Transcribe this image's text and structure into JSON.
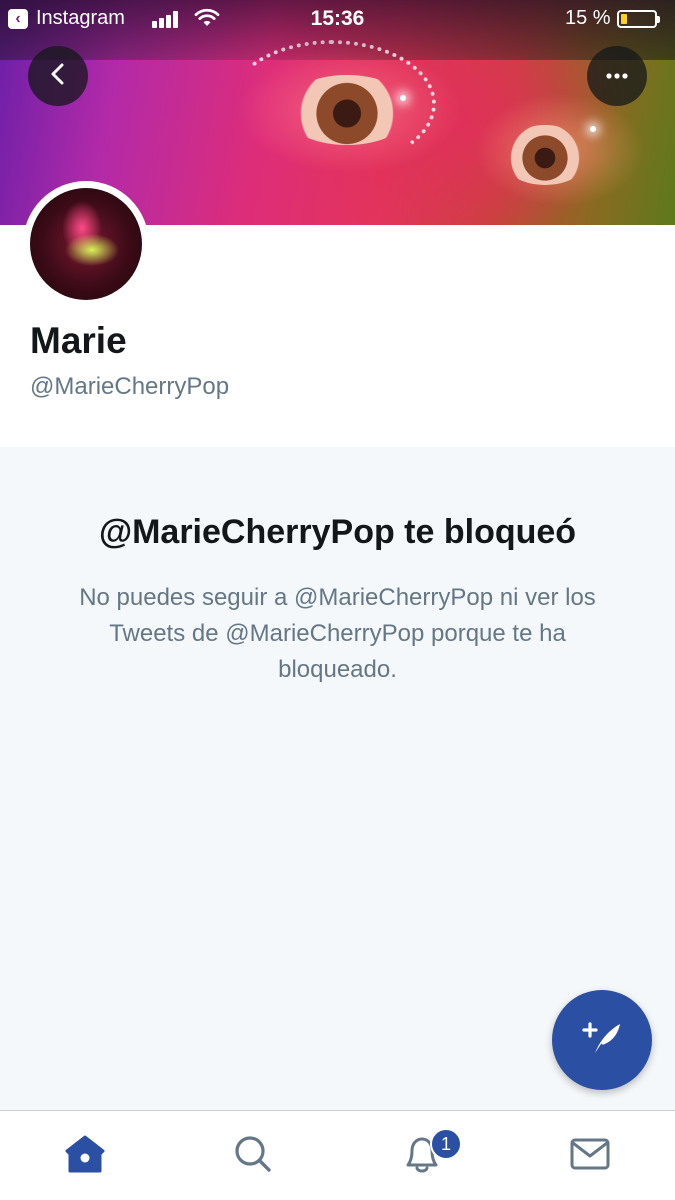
{
  "status_bar": {
    "back_app": "Instagram",
    "time": "15:36",
    "battery_percent": "15 %",
    "battery_level": 0.15
  },
  "header": {
    "back_icon": "chevron-left-icon",
    "more_icon": "more-horizontal-icon"
  },
  "profile": {
    "name": "Marie",
    "handle": "@MarieCherryPop"
  },
  "blocked": {
    "title": "@MarieCherryPop te bloqueó",
    "message": "No puedes seguir a @MarieCherryPop ni ver los Tweets de @MarieCherryPop porque te ha bloqueado."
  },
  "fab": {
    "icon": "compose-tweet-icon"
  },
  "tabbar": {
    "items": [
      {
        "icon": "home-icon",
        "active": true
      },
      {
        "icon": "search-icon",
        "active": false
      },
      {
        "icon": "bell-icon",
        "active": false,
        "badge": "1"
      },
      {
        "icon": "mail-icon",
        "active": false
      }
    ]
  },
  "colors": {
    "accent": "#2a4fa3",
    "text_primary": "#14171a",
    "text_secondary": "#657786",
    "background": "#f5f8fa"
  }
}
